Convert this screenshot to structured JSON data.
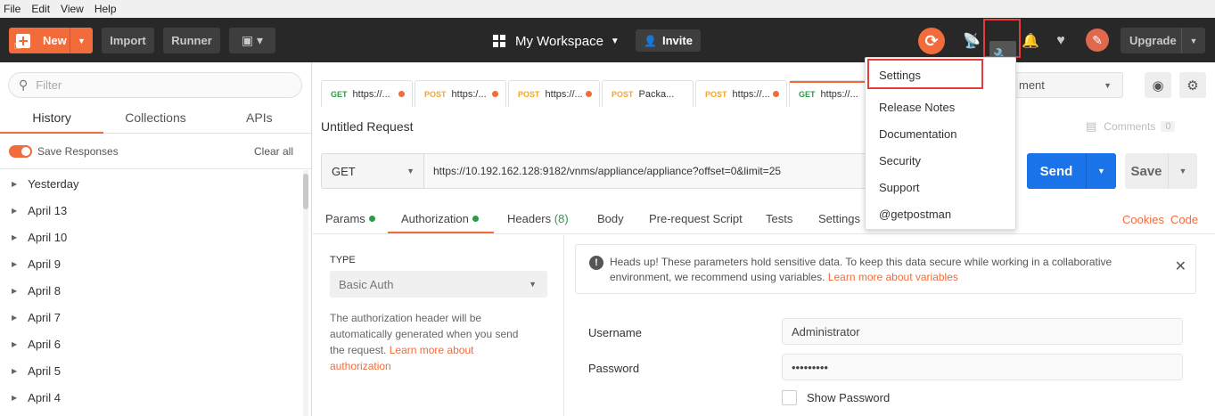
{
  "menubar": [
    "File",
    "Edit",
    "View",
    "Help"
  ],
  "header": {
    "new_label": "New",
    "import_label": "Import",
    "runner_label": "Runner",
    "workspace_label": "My Workspace",
    "invite_label": "Invite",
    "upgrade_label": "Upgrade"
  },
  "sidebar": {
    "filter_placeholder": "Filter",
    "tabs": [
      "History",
      "Collections",
      "APIs"
    ],
    "save_responses_label": "Save Responses",
    "clear_all_label": "Clear all",
    "history": [
      "Yesterday",
      "April 13",
      "April 10",
      "April 9",
      "April 8",
      "April 7",
      "April 6",
      "April 5",
      "April 4"
    ]
  },
  "request_tabs": [
    {
      "method": "GET",
      "title": "https://..."
    },
    {
      "method": "POST",
      "title": "https:/..."
    },
    {
      "method": "POST",
      "title": "https://..."
    },
    {
      "method": "POST",
      "title": "Packa..."
    },
    {
      "method": "POST",
      "title": "https://..."
    },
    {
      "method": "GET",
      "title": "https://..."
    }
  ],
  "environment": {
    "selected": "ment"
  },
  "request": {
    "title": "Untitled Request",
    "comments_label": "Comments",
    "comments_count": "0",
    "method": "GET",
    "url": "https://10.192.162.128:9182/vnms/appliance/appliance?offset=0&limit=25",
    "send_label": "Send",
    "save_label": "Save"
  },
  "subtabs": {
    "params": "Params",
    "authorization": "Authorization",
    "headers": "Headers",
    "headers_count": "(8)",
    "body": "Body",
    "prerequest": "Pre-request Script",
    "tests": "Tests",
    "settings": "Settings",
    "cookies": "Cookies",
    "code": "Code"
  },
  "auth": {
    "type_label": "TYPE",
    "type_value": "Basic Auth",
    "description": "The authorization header will be automatically generated when you send the request.",
    "learn_more": "Learn more about authorization",
    "notice_text": "Heads up! These parameters hold sensitive data. To keep this data secure while working in a collaborative environment, we recommend using variables.",
    "notice_link": "Learn more about variables",
    "username_label": "Username",
    "username_value": "Administrator",
    "password_label": "Password",
    "password_value": "•••••••••",
    "show_password_label": "Show Password"
  },
  "dropdown": [
    "Settings",
    "Release Notes",
    "Documentation",
    "Security",
    "Support",
    "@getpostman"
  ],
  "colors": {
    "accent": "#f26b3a",
    "send": "#1a73e8",
    "header_bg": "#282828",
    "highlight": "#e33d3d"
  }
}
